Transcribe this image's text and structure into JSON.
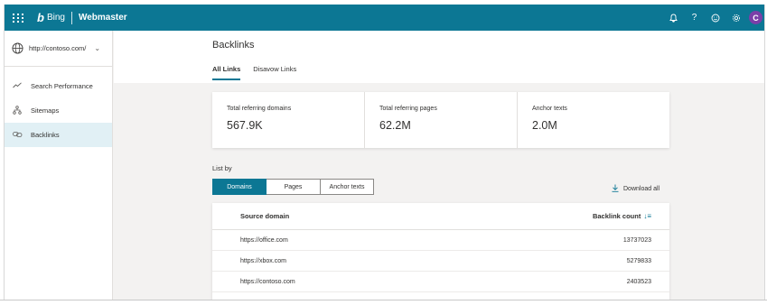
{
  "header": {
    "brand": "Bing",
    "product": "Webmaster",
    "avatar_initial": "C",
    "icons": [
      "notification-icon",
      "help-icon",
      "feedback-icon",
      "settings-icon"
    ],
    "bar_color": "#0c7794"
  },
  "sidebar": {
    "site": "http://contoso.com/",
    "items": [
      {
        "label": "Search Performance",
        "icon": "trend-icon"
      },
      {
        "label": "Sitemaps",
        "icon": "sitemap-icon"
      },
      {
        "label": "Backlinks",
        "icon": "link-icon",
        "active": true
      }
    ]
  },
  "main": {
    "title": "Backlinks",
    "tabs": [
      {
        "label": "All Links",
        "active": true
      },
      {
        "label": "Disavow Links",
        "active": false
      }
    ],
    "stats": [
      {
        "label": "Total referring domains",
        "value": "567.9K"
      },
      {
        "label": "Total referring pages",
        "value": "62.2M"
      },
      {
        "label": "Anchor texts",
        "value": "2.0M"
      }
    ],
    "list_by_label": "List by",
    "segments": [
      {
        "label": "Domains",
        "active": true
      },
      {
        "label": "Pages",
        "active": false
      },
      {
        "label": "Anchor texts",
        "active": false
      }
    ],
    "download_label": "Download all",
    "table": {
      "col_source": "Source domain",
      "col_count": "Backlink count",
      "rows": [
        {
          "domain": "https://office.com",
          "count": "13737023"
        },
        {
          "domain": "https://xbox.com",
          "count": "5279833"
        },
        {
          "domain": "https://contoso.com",
          "count": "2403523"
        }
      ]
    }
  }
}
